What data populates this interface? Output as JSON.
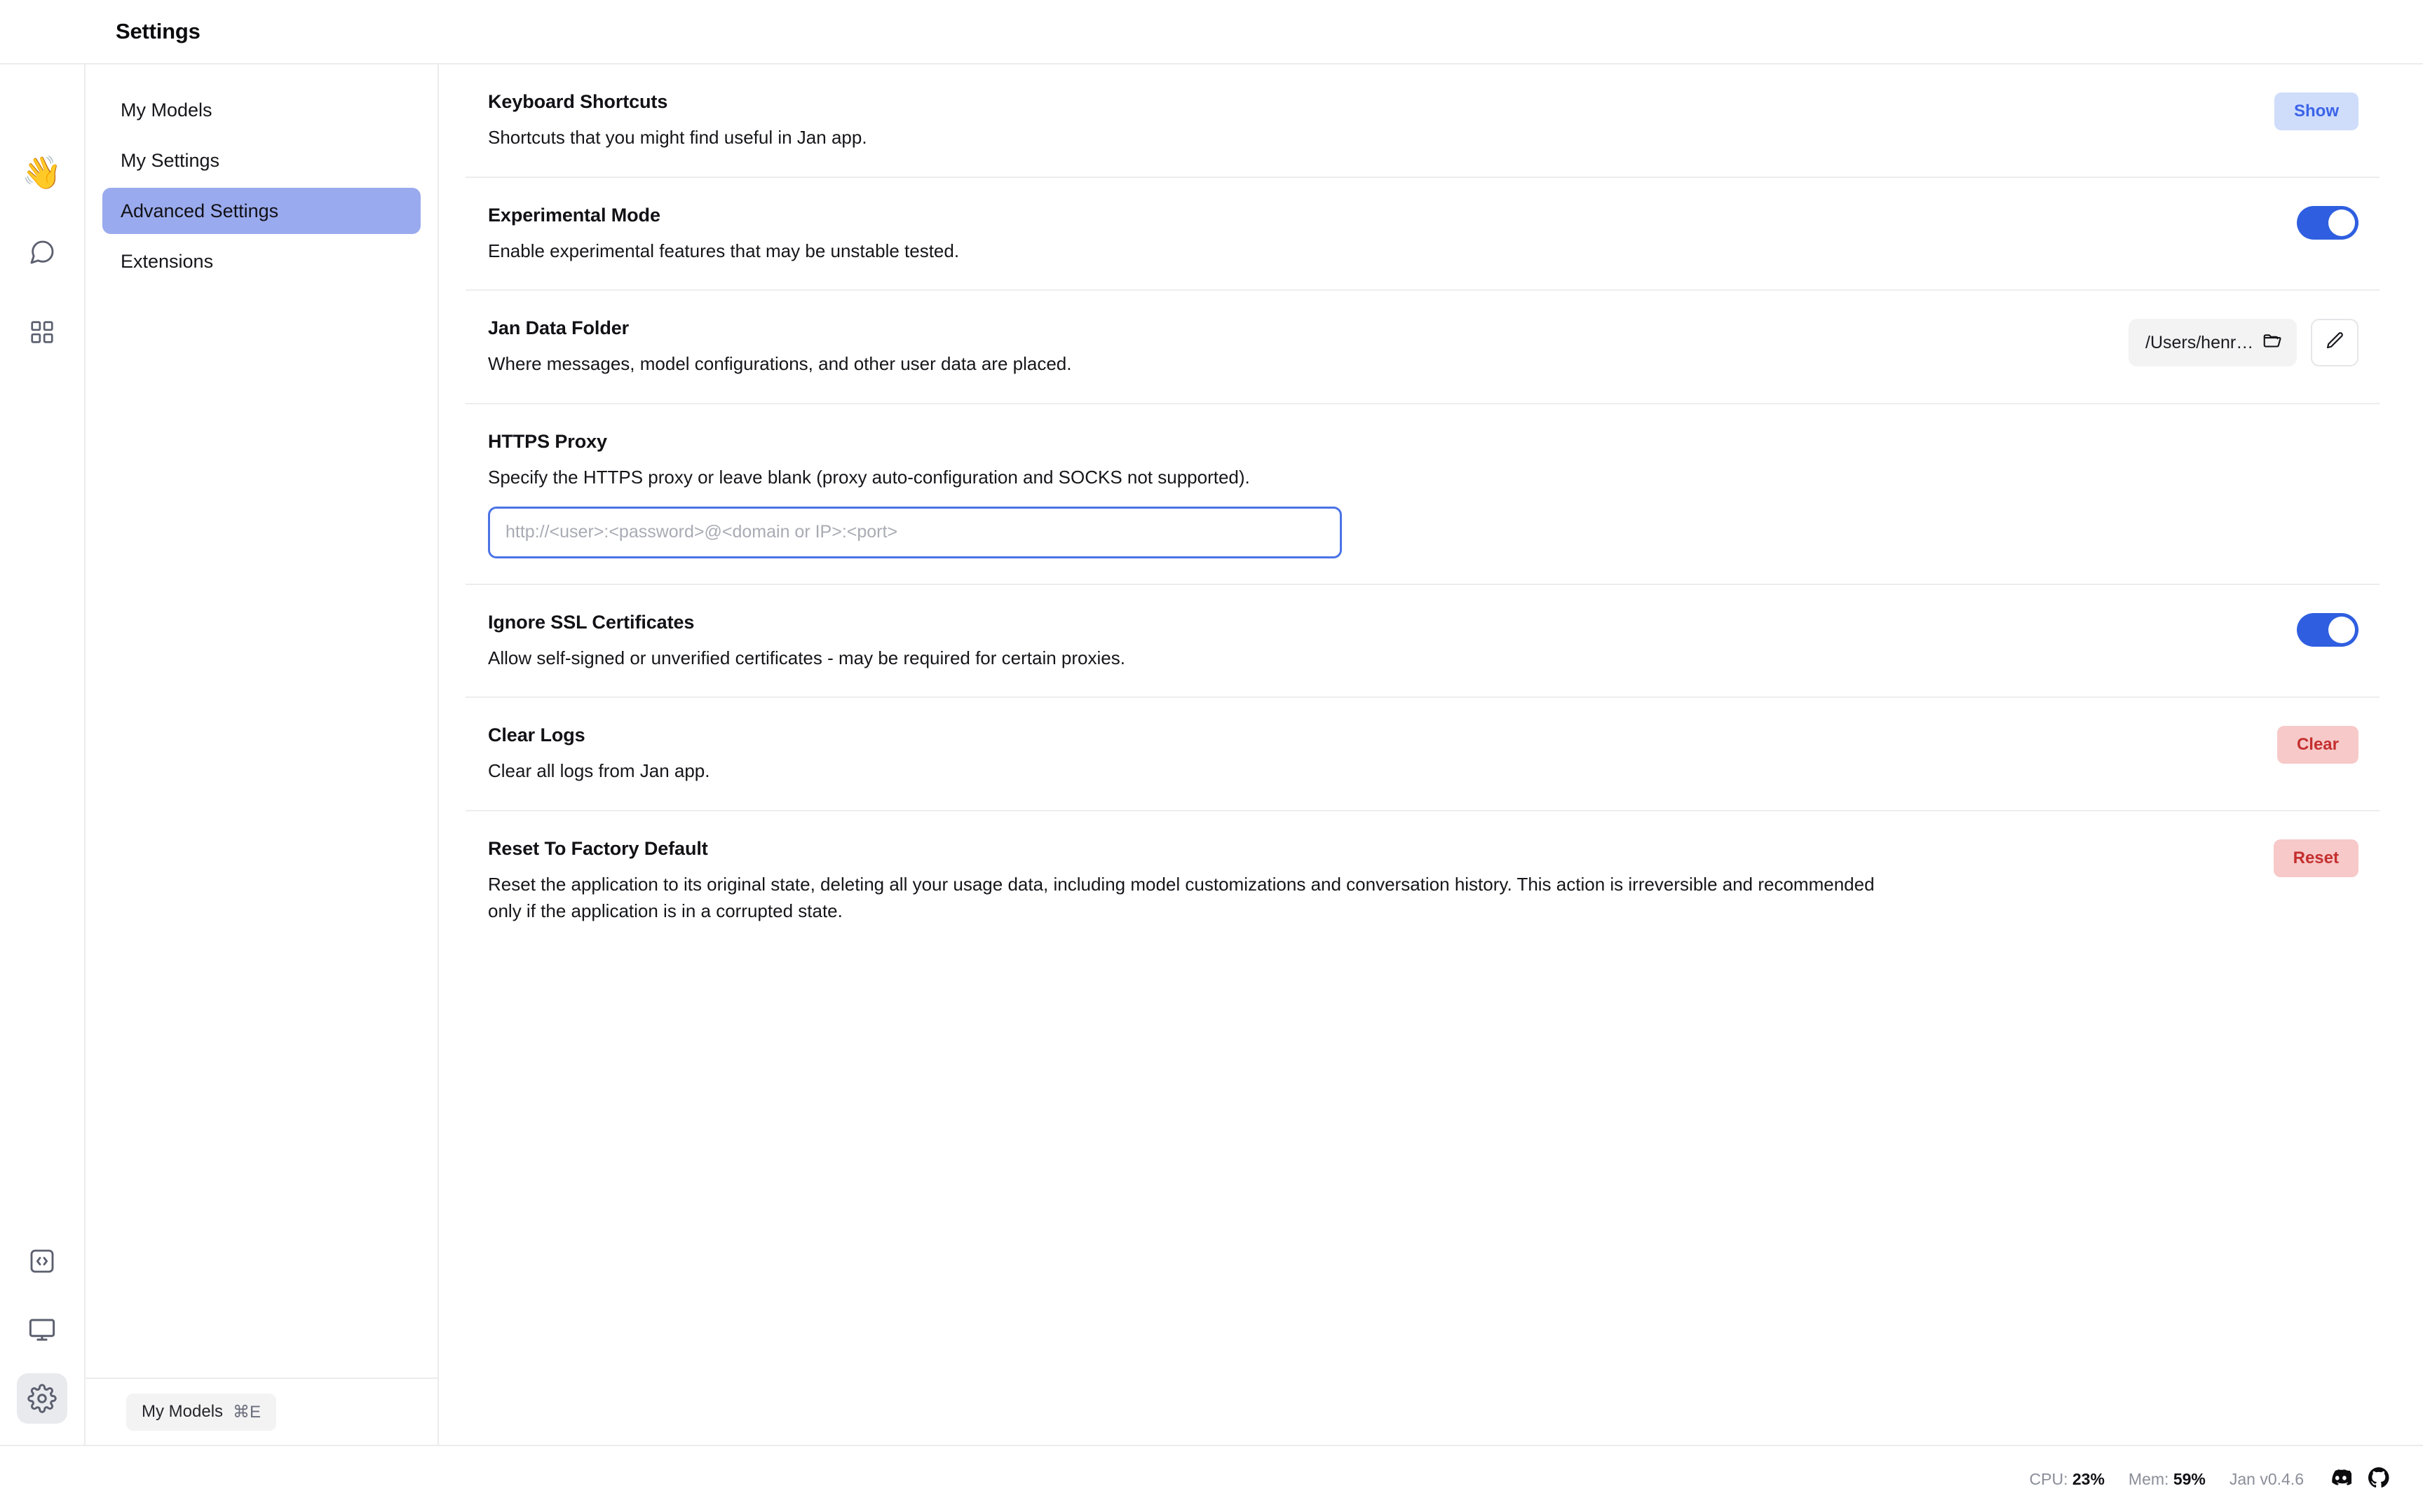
{
  "window": {
    "title": "Settings"
  },
  "rail": {
    "items": [
      {
        "name": "wave-emoji",
        "glyph": "👋"
      },
      {
        "name": "chat-bubble-icon"
      },
      {
        "name": "grid-apps-icon"
      },
      {
        "name": "code-brackets-icon"
      },
      {
        "name": "monitor-icon"
      },
      {
        "name": "gear-icon"
      }
    ]
  },
  "sidebar": {
    "items": [
      {
        "label": "My Models",
        "active": false
      },
      {
        "label": "My Settings",
        "active": false
      },
      {
        "label": "Advanced Settings",
        "active": true
      },
      {
        "label": "Extensions",
        "active": false
      }
    ],
    "footer": {
      "button_label": "My Models",
      "shortcut": "⌘E"
    }
  },
  "settings": {
    "keyboard_shortcuts": {
      "title": "Keyboard Shortcuts",
      "description": "Shortcuts that you might find useful in Jan app.",
      "button_label": "Show"
    },
    "experimental_mode": {
      "title": "Experimental Mode",
      "description": "Enable experimental features that may be unstable tested.",
      "toggle_on": true
    },
    "jan_data_folder": {
      "title": "Jan Data Folder",
      "description": "Where messages, model configurations, and other user data are placed.",
      "path": "/Users/henry/jan",
      "folder_icon": "open-folder-icon",
      "edit_icon": "pencil-icon"
    },
    "https_proxy": {
      "title": "HTTPS Proxy",
      "description": "Specify the HTTPS proxy or leave blank (proxy auto-configuration and SOCKS not supported).",
      "value": "",
      "placeholder": "http://<user>:<password>@<domain or IP>:<port>"
    },
    "ignore_ssl": {
      "title": "Ignore SSL Certificates",
      "description": "Allow self-signed or unverified certificates - may be required for certain proxies.",
      "toggle_on": true
    },
    "clear_logs": {
      "title": "Clear Logs",
      "description": "Clear all logs from Jan app.",
      "button_label": "Clear"
    },
    "reset_factory": {
      "title": "Reset To Factory Default",
      "description": "Reset the application to its original state, deleting all your usage data, including model customizations and conversation history. This action is irreversible and recommended only if the application is in a corrupted state.",
      "button_label": "Reset"
    }
  },
  "statusbar": {
    "cpu_label": "CPU:",
    "cpu_value": "23%",
    "mem_label": "Mem:",
    "mem_value": "59%",
    "version": "Jan v0.4.6",
    "discord_icon": "discord-icon",
    "github_icon": "github-icon"
  },
  "colors": {
    "accent_blue": "#2f5fe0",
    "sidebar_active": "#9aaaee",
    "show_button_bg": "#cfddfb",
    "show_button_text": "#3b63e8",
    "danger_bg": "#f7c9c9",
    "danger_text": "#c52f2f"
  }
}
